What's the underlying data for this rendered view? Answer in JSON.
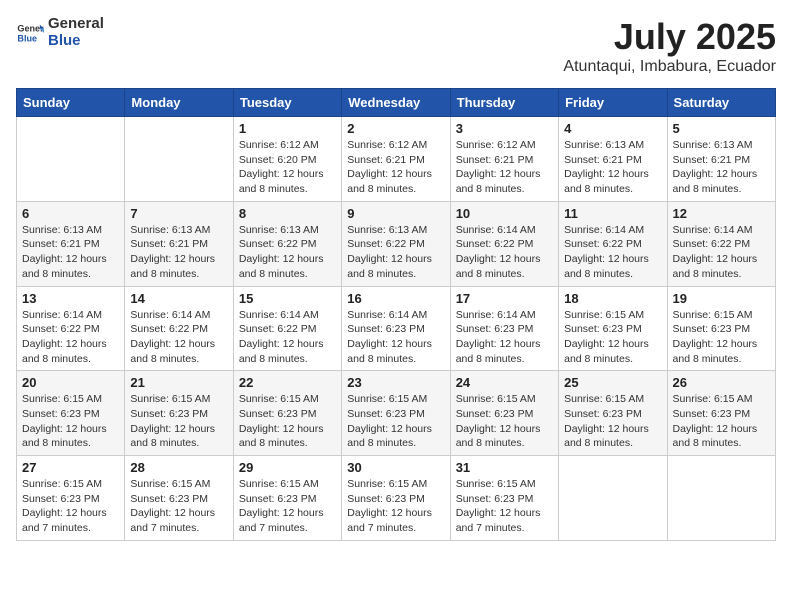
{
  "logo": {
    "general": "General",
    "blue": "Blue"
  },
  "header": {
    "title": "July 2025",
    "subtitle": "Atuntaqui, Imbabura, Ecuador"
  },
  "days_of_week": [
    "Sunday",
    "Monday",
    "Tuesday",
    "Wednesday",
    "Thursday",
    "Friday",
    "Saturday"
  ],
  "weeks": [
    [
      {
        "day": "",
        "info": ""
      },
      {
        "day": "",
        "info": ""
      },
      {
        "day": "1",
        "info": "Sunrise: 6:12 AM\nSunset: 6:20 PM\nDaylight: 12 hours and 8 minutes."
      },
      {
        "day": "2",
        "info": "Sunrise: 6:12 AM\nSunset: 6:21 PM\nDaylight: 12 hours and 8 minutes."
      },
      {
        "day": "3",
        "info": "Sunrise: 6:12 AM\nSunset: 6:21 PM\nDaylight: 12 hours and 8 minutes."
      },
      {
        "day": "4",
        "info": "Sunrise: 6:13 AM\nSunset: 6:21 PM\nDaylight: 12 hours and 8 minutes."
      },
      {
        "day": "5",
        "info": "Sunrise: 6:13 AM\nSunset: 6:21 PM\nDaylight: 12 hours and 8 minutes."
      }
    ],
    [
      {
        "day": "6",
        "info": "Sunrise: 6:13 AM\nSunset: 6:21 PM\nDaylight: 12 hours and 8 minutes."
      },
      {
        "day": "7",
        "info": "Sunrise: 6:13 AM\nSunset: 6:21 PM\nDaylight: 12 hours and 8 minutes."
      },
      {
        "day": "8",
        "info": "Sunrise: 6:13 AM\nSunset: 6:22 PM\nDaylight: 12 hours and 8 minutes."
      },
      {
        "day": "9",
        "info": "Sunrise: 6:13 AM\nSunset: 6:22 PM\nDaylight: 12 hours and 8 minutes."
      },
      {
        "day": "10",
        "info": "Sunrise: 6:14 AM\nSunset: 6:22 PM\nDaylight: 12 hours and 8 minutes."
      },
      {
        "day": "11",
        "info": "Sunrise: 6:14 AM\nSunset: 6:22 PM\nDaylight: 12 hours and 8 minutes."
      },
      {
        "day": "12",
        "info": "Sunrise: 6:14 AM\nSunset: 6:22 PM\nDaylight: 12 hours and 8 minutes."
      }
    ],
    [
      {
        "day": "13",
        "info": "Sunrise: 6:14 AM\nSunset: 6:22 PM\nDaylight: 12 hours and 8 minutes."
      },
      {
        "day": "14",
        "info": "Sunrise: 6:14 AM\nSunset: 6:22 PM\nDaylight: 12 hours and 8 minutes."
      },
      {
        "day": "15",
        "info": "Sunrise: 6:14 AM\nSunset: 6:22 PM\nDaylight: 12 hours and 8 minutes."
      },
      {
        "day": "16",
        "info": "Sunrise: 6:14 AM\nSunset: 6:23 PM\nDaylight: 12 hours and 8 minutes."
      },
      {
        "day": "17",
        "info": "Sunrise: 6:14 AM\nSunset: 6:23 PM\nDaylight: 12 hours and 8 minutes."
      },
      {
        "day": "18",
        "info": "Sunrise: 6:15 AM\nSunset: 6:23 PM\nDaylight: 12 hours and 8 minutes."
      },
      {
        "day": "19",
        "info": "Sunrise: 6:15 AM\nSunset: 6:23 PM\nDaylight: 12 hours and 8 minutes."
      }
    ],
    [
      {
        "day": "20",
        "info": "Sunrise: 6:15 AM\nSunset: 6:23 PM\nDaylight: 12 hours and 8 minutes."
      },
      {
        "day": "21",
        "info": "Sunrise: 6:15 AM\nSunset: 6:23 PM\nDaylight: 12 hours and 8 minutes."
      },
      {
        "day": "22",
        "info": "Sunrise: 6:15 AM\nSunset: 6:23 PM\nDaylight: 12 hours and 8 minutes."
      },
      {
        "day": "23",
        "info": "Sunrise: 6:15 AM\nSunset: 6:23 PM\nDaylight: 12 hours and 8 minutes."
      },
      {
        "day": "24",
        "info": "Sunrise: 6:15 AM\nSunset: 6:23 PM\nDaylight: 12 hours and 8 minutes."
      },
      {
        "day": "25",
        "info": "Sunrise: 6:15 AM\nSunset: 6:23 PM\nDaylight: 12 hours and 8 minutes."
      },
      {
        "day": "26",
        "info": "Sunrise: 6:15 AM\nSunset: 6:23 PM\nDaylight: 12 hours and 8 minutes."
      }
    ],
    [
      {
        "day": "27",
        "info": "Sunrise: 6:15 AM\nSunset: 6:23 PM\nDaylight: 12 hours and 7 minutes."
      },
      {
        "day": "28",
        "info": "Sunrise: 6:15 AM\nSunset: 6:23 PM\nDaylight: 12 hours and 7 minutes."
      },
      {
        "day": "29",
        "info": "Sunrise: 6:15 AM\nSunset: 6:23 PM\nDaylight: 12 hours and 7 minutes."
      },
      {
        "day": "30",
        "info": "Sunrise: 6:15 AM\nSunset: 6:23 PM\nDaylight: 12 hours and 7 minutes."
      },
      {
        "day": "31",
        "info": "Sunrise: 6:15 AM\nSunset: 6:23 PM\nDaylight: 12 hours and 7 minutes."
      },
      {
        "day": "",
        "info": ""
      },
      {
        "day": "",
        "info": ""
      }
    ]
  ]
}
